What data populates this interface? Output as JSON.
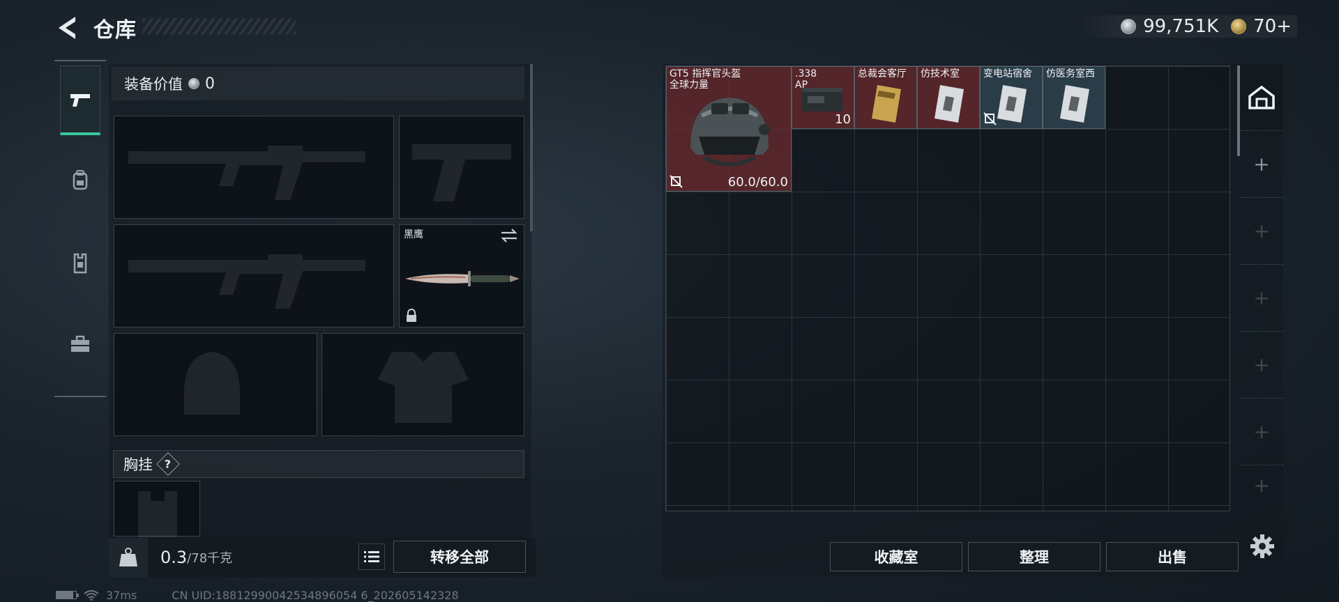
{
  "header": {
    "title": "仓库",
    "currencies": [
      {
        "icon": "silver-coin-icon",
        "value": "99,751K"
      },
      {
        "icon": "gold-coin-icon",
        "value": "70+"
      }
    ]
  },
  "equipment": {
    "value_label": "装备价值",
    "value": "0",
    "knife_label": "黑鹰",
    "chest_label": "胸挂",
    "help_glyph": "?",
    "weight_value": "0.3",
    "weight_max": "/78千克",
    "transfer_all": "转移全部"
  },
  "stash": {
    "items": [
      {
        "name": "GT5 指挥官头盔\n全球力量",
        "durability": "60.0/60.0",
        "color": "red"
      },
      {
        "name": ".338\nAP",
        "count": "10",
        "color": "red"
      },
      {
        "name": "总裁会客厅",
        "color": "red"
      },
      {
        "name": "仿技术室",
        "color": "red"
      },
      {
        "name": "变电站宿舍",
        "color": "blue"
      },
      {
        "name": "仿医务室西",
        "color": "blue"
      }
    ],
    "buttons": {
      "collection": "收藏室",
      "sort": "整理",
      "sell": "出售"
    },
    "add_glyph": "+"
  },
  "status": {
    "battery_level": 0.85,
    "ping": "37ms",
    "uid": "CN UID:18812990042534896054 6_202605142328"
  },
  "colors": {
    "accent": "#38c79a",
    "rare_red": "#782c30",
    "rare_blue": "#344858"
  }
}
